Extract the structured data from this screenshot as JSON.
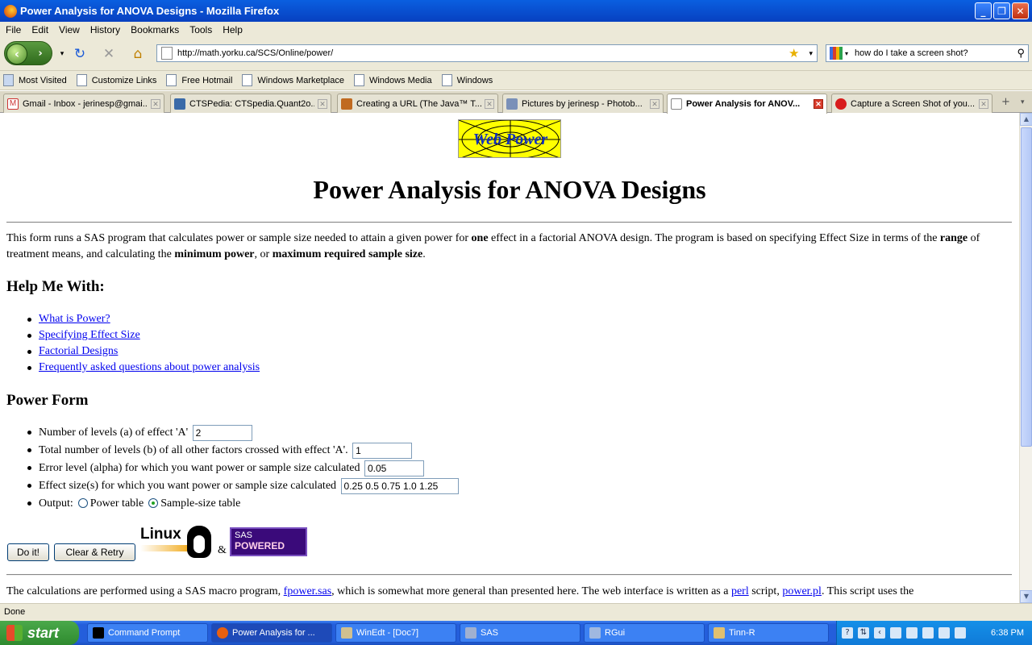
{
  "window": {
    "title": "Power Analysis for ANOVA Designs - Mozilla Firefox"
  },
  "menu": [
    "File",
    "Edit",
    "View",
    "History",
    "Bookmarks",
    "Tools",
    "Help"
  ],
  "nav": {
    "url": "http://math.yorku.ca/SCS/Online/power/",
    "search": "how do I take a screen shot?"
  },
  "bookmarks": [
    "Most Visited",
    "Customize Links",
    "Free Hotmail",
    "Windows Marketplace",
    "Windows Media",
    "Windows"
  ],
  "tabs": [
    {
      "label": "Gmail - Inbox - jerinesp@gmai...",
      "active": false
    },
    {
      "label": "CTSPedia: CTSpedia.Quant2o...",
      "active": false
    },
    {
      "label": "Creating a URL (The Java™ T...",
      "active": false
    },
    {
      "label": "Pictures by jerinesp - Photob...",
      "active": false
    },
    {
      "label": "Power Analysis for ANOV...",
      "active": true
    },
    {
      "label": "Capture a Screen Shot of you...",
      "active": false
    }
  ],
  "page": {
    "logo": "Web Power",
    "title": "Power Analysis for ANOVA Designs",
    "intro": {
      "p1": "This form runs a SAS program that calculates power or sample size needed to attain a given power for ",
      "b1": "one",
      "p2": " effect in a factorial ANOVA design. The program is based on specifying Effect Size in terms of the ",
      "b2": "range",
      "p3": " of treatment means, and calculating the ",
      "b3": "minimum power",
      "p4": ", or ",
      "b4": "maximum required sample size",
      "p5": "."
    },
    "help_heading": "Help Me With:",
    "help_links": [
      "What is Power?",
      "Specifying Effect Size",
      "Factorial Designs",
      "Frequently asked questions about power analysis"
    ],
    "form_heading": "Power Form",
    "form": {
      "levels_a_label": "Number of levels (a) of effect 'A'",
      "levels_a": "2",
      "levels_b_label": "Total number of levels (b) of all other factors crossed with effect 'A'.",
      "levels_b": "1",
      "alpha_label": "Error level (alpha) for which you want power or sample size calculated",
      "alpha": "0.05",
      "effect_label": "Effect size(s) for which you want power or sample size calculated",
      "effect": "0.25 0.5 0.75 1.0 1.25",
      "output_label": "Output:",
      "output_opt1": "Power table",
      "output_opt2": "Sample-size table",
      "output_selected": "Sample-size table"
    },
    "buttons": {
      "doit": "Do it!",
      "clear": "Clear & Retry"
    },
    "badges": {
      "linux": "Linux",
      "amp": "&",
      "sas1": "SAS",
      "sas2": "POWERED"
    },
    "footer": {
      "t1": "The calculations are performed using a SAS macro program, ",
      "l1": "fpower.sas",
      "t2": ", which is somewhat more general than presented here. The web interface is written as a ",
      "l2": "perl",
      "t3": " script, ",
      "l3": "power.pl",
      "t4": ". This script uses the"
    }
  },
  "status": "Done",
  "taskbar": {
    "start": "start",
    "items": [
      "Command Prompt",
      "Power Analysis for ...",
      "WinEdt - [Doc7]",
      "SAS",
      "RGui",
      "Tinn-R"
    ],
    "clock": "6:38 PM"
  }
}
